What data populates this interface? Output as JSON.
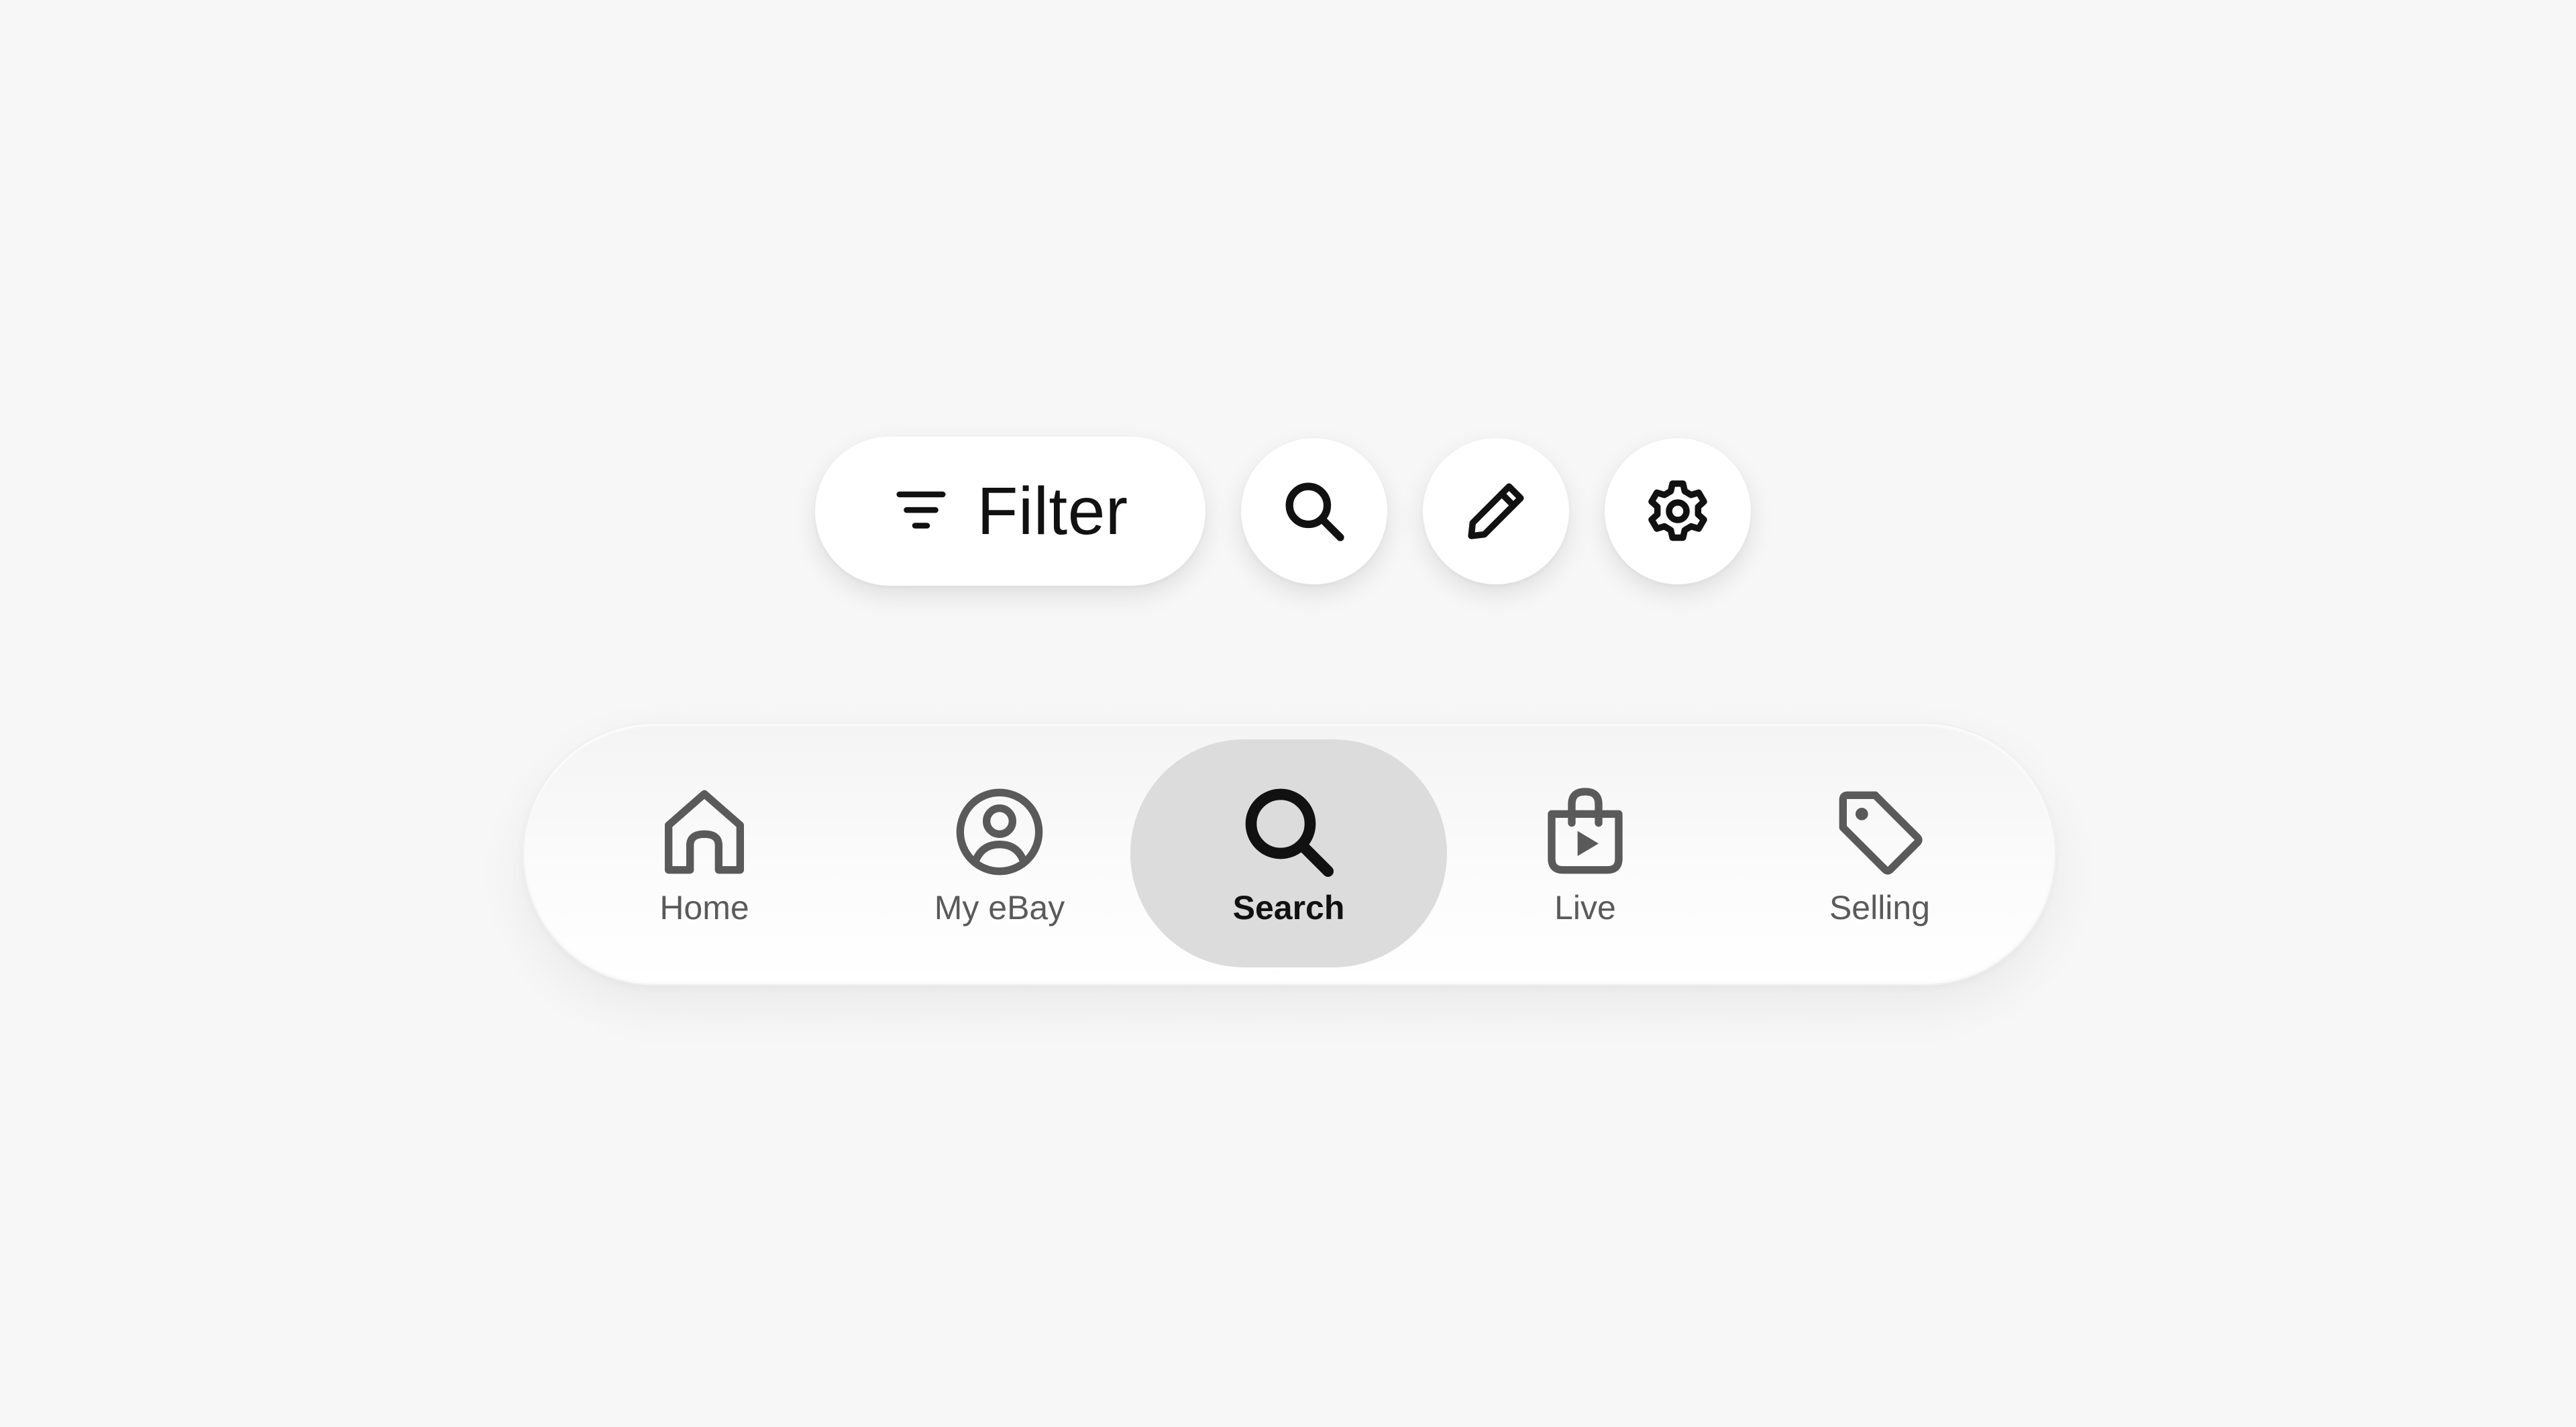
{
  "action_row": {
    "filter": {
      "label": "Filter",
      "icon": "filter-icon"
    },
    "search_button": {
      "icon": "search-icon"
    },
    "edit_button": {
      "icon": "pencil-icon"
    },
    "settings_button": {
      "icon": "gear-icon"
    }
  },
  "tab_bar": {
    "selected": "Search",
    "items": [
      {
        "label": "Home",
        "icon": "home-icon",
        "active": false
      },
      {
        "label": "My eBay",
        "icon": "user-circle-icon",
        "active": false
      },
      {
        "label": "Search",
        "icon": "search-icon",
        "active": true
      },
      {
        "label": "Live",
        "icon": "shopping-bag-play-icon",
        "active": false
      },
      {
        "label": "Selling",
        "icon": "tag-icon",
        "active": false
      }
    ]
  },
  "colors": {
    "background": "#f7f7f7",
    "button_surface": "#ffffff",
    "active_tab": "#dcdcdc",
    "icon_dark": "#111111",
    "icon_muted": "#5a5a5a"
  }
}
